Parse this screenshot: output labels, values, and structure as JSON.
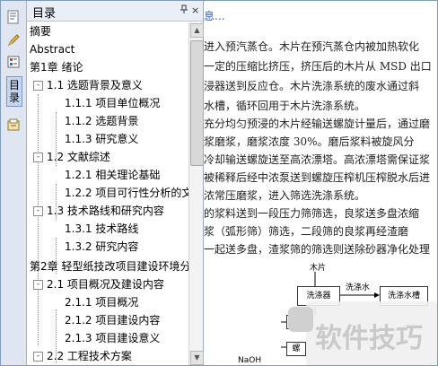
{
  "panel": {
    "title": "目录",
    "pin_glyph": "ᵖ",
    "close_glyph": "×",
    "vertical_tab": "目\n录"
  },
  "toc": [
    {
      "text": "摘要",
      "level": 0,
      "toggle": ""
    },
    {
      "text": "Abstract",
      "level": 0,
      "toggle": ""
    },
    {
      "text": "第1章 绪论",
      "level": 0,
      "toggle": ""
    },
    {
      "text": "1.1 选题背景及意义",
      "level": 1,
      "toggle": "-"
    },
    {
      "text": "1.1.1 项目单位概况",
      "level": 2,
      "toggle": ""
    },
    {
      "text": "1.1.2 选题背景",
      "level": 2,
      "toggle": ""
    },
    {
      "text": "1.1.3 研究意义",
      "level": 2,
      "toggle": ""
    },
    {
      "text": "1.2 文献综述",
      "level": 1,
      "toggle": "-"
    },
    {
      "text": "1.2.1 相关理论基础",
      "level": 2,
      "toggle": ""
    },
    {
      "text": "1.2.2 项目可行性分析的文",
      "level": 2,
      "toggle": ""
    },
    {
      "text": "1.3 技术路线和研究内容",
      "level": 1,
      "toggle": "-"
    },
    {
      "text": "1.3.1 技术路线",
      "level": 2,
      "toggle": ""
    },
    {
      "text": "1.3.2 研究内容",
      "level": 2,
      "toggle": ""
    },
    {
      "text": "第2章 轻型纸技改项目建设环境分",
      "level": 0,
      "toggle": ""
    },
    {
      "text": "2.1 项目概况及建设内容",
      "level": 1,
      "toggle": "-"
    },
    {
      "text": "2.1.1 项目概况",
      "level": 2,
      "toggle": ""
    },
    {
      "text": "2.1.2 项目建设内容",
      "level": 2,
      "toggle": ""
    },
    {
      "text": "2.1.3 项目建设意义",
      "level": 2,
      "toggle": ""
    },
    {
      "text": "2.2 工程技术方案",
      "level": 1,
      "toggle": "-"
    }
  ],
  "doc": {
    "top_link": "息...",
    "lines": [
      "进入预汽蒸仓。木片在预汽蒸仓内被加热软化",
      "一定的压缩比挤压，挤压后的木片从 MSD 出口",
      "浸器送到反应仓。木片洗涤系统的废水通过斜",
      "水槽，循环回用于木片洗涤系统。",
      "充分均匀预浸的木片经输送螺旋计量后，通过磨",
      "浆磨浆，磨浆浓度 30%。磨后浆料被旋风分",
      "冷却输送螺旋送至高浓漂塔。高浓漂塔需保证浆",
      "被稀释后经中浓泵送到螺旋压榨机压榨脱水后进",
      "浓常压磨浆，进入筛选洗涤系统。",
      "的浆料送到一段压力筛筛选，良浆送多盘浓缩",
      "浆（弧形筛）筛选，二段筛的良浆再经渣磨",
      "一起送多盘，渣浆筛的筛选则送除砂器净化处理"
    ],
    "diagram": {
      "label_top": "木片",
      "box1": "洗涤器",
      "arrow_label": "洗涤水",
      "box2": "洗涤水槽",
      "box3": "螺",
      "box4": "螺",
      "box5": "螺",
      "bottom": "NaOH"
    }
  },
  "watermark": {
    "text": "软件技巧"
  }
}
